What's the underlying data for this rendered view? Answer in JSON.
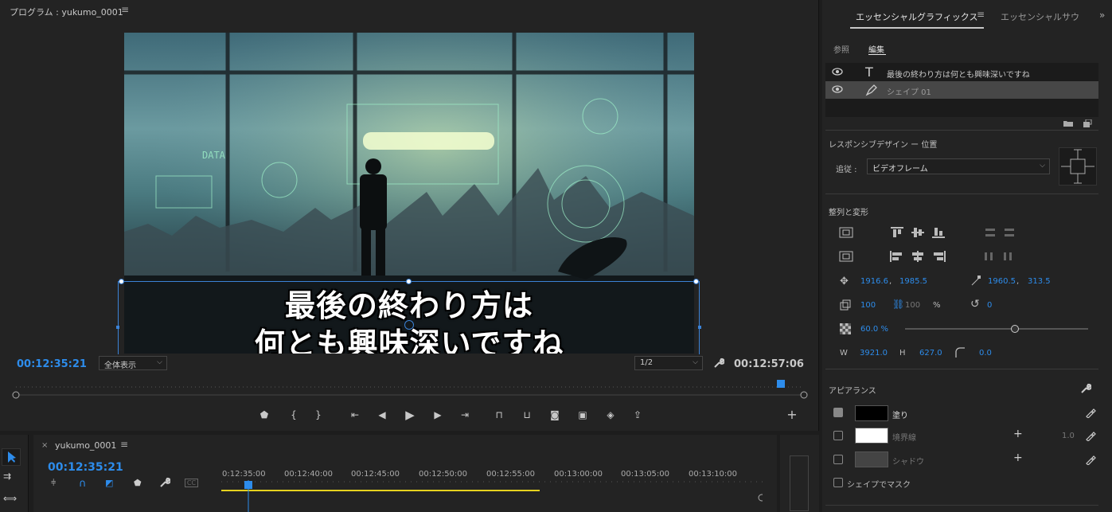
{
  "program": {
    "title": "プログラム : yukumo_0001",
    "menu_icon": "hamburger-icon",
    "caption_line1": "最後の終わり方は",
    "caption_line2": "何とも興味深いですね",
    "timecode_current": "00:12:35:21",
    "fit_select": "全体表示",
    "resolution_select": "1/2",
    "timecode_duration": "00:12:57:06"
  },
  "timeline": {
    "sequence_close": "×",
    "sequence_name": "yukumo_0001",
    "timecode": "00:12:35:21",
    "ticks": [
      "0:12:35:00",
      "00:12:40:00",
      "00:12:45:00",
      "00:12:50:00",
      "00:12:55:00",
      "00:13:00:00",
      "00:13:05:00",
      "00:13:10:00"
    ]
  },
  "panel": {
    "tab_active": "エッセンシャルグラフィックス",
    "tab_other": "エッセンシャルサウンド",
    "more": "»",
    "sub_browse": "参照",
    "sub_edit": "編集",
    "layers": [
      {
        "type": "T",
        "name": "最後の終わり方は何とも興味深いですね"
      },
      {
        "type": "pen",
        "name": "シェイプ 01"
      }
    ],
    "responsive_title": "レスポンシブデザイン ー 位置",
    "follow_label": "追従 :",
    "follow_value": "ビデオフレーム",
    "align_title": "整列と変形",
    "position_x": "1916.6",
    "position_y": "1985.5",
    "anchor_x": "1960.5",
    "anchor_y": "313.5",
    "scale": "100",
    "scale_locked": "100",
    "scale_unit": "%",
    "rotation": "0",
    "opacity": "60.0 %",
    "opacity_value": 0.6,
    "w_label": "W",
    "width": "3921.0",
    "h_label": "H",
    "height": "627.0",
    "corner": "0.0",
    "appearance_title": "アピアランス",
    "fill_label": "塗り",
    "fill_color": "#000000",
    "stroke_label": "境界線",
    "stroke_color": "#ffffff",
    "stroke_width": "1.0",
    "shadow_label": "シャドウ",
    "mask_label": "シェイプでマスク",
    "comma": ","
  }
}
